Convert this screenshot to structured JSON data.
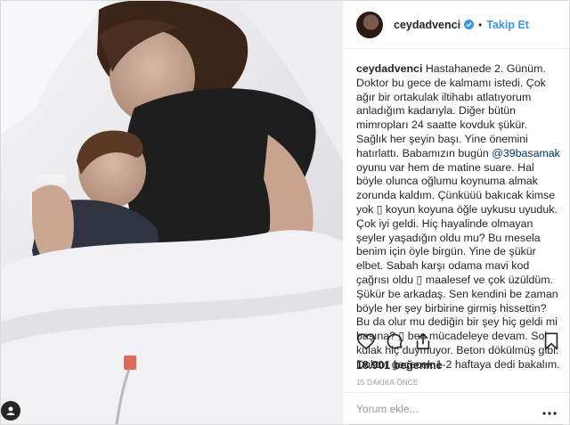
{
  "post": {
    "username": "ceydadvenci",
    "follow_label": "Takip Et",
    "separator": "•",
    "caption": {
      "author": "ceydadvenci",
      "text_before_mention": " Hastahanede 2. Günüm. Doktor bu gece de kalmamı istedi. Çok ağır bir ortakulak iltihabı atlatıyorum anladığım kadarıyla. Diğer bütün mimropları 24 saatte kovduk şükür. Sağlık her şeyin başı. Yine önemini hatırlattı. Babamızın bugün ",
      "mention": "@39basamak",
      "text_after_mention": " oyunu var hem de matine suare. Hal böyle olunca oğlumu koynuma almak zorunda kaldım. Çünküüü bakıcak kimse yok ▯ koyun koyuna öğle uykusu uyuduk. Çok iyi geldi. Hiç hayalinde olmayan şeyler yaşadığın oldu mu? Bu mesela benim için öyle birgün. Yine de şükür elbet. Sabah karşı odama mavi kod çağrısı oldu ▯ maalesef ve çok üzüldüm. Şükür be arkadaş. Sen kendini be zaman böyle her şey birbirine girmiş hissettin? Bu da olur mu dediğin bir şey hiç geldi mi başına? ▯ ben mücadeleye devam. Sol kulak hiç duymuyor. Beton dökülmüş gibi. Doktor geçecek 1-2 haftaya dedi bakalım."
    },
    "likes": "18.901 beğenme",
    "timestamp": "15 DAKİKA ÖNCE",
    "comment_placeholder": "Yorum ekle...",
    "icons": {
      "like": "heart-icon",
      "comment": "comment-icon",
      "share": "share-icon",
      "save": "bookmark-icon",
      "more": "more-icon",
      "verified": "verified-badge-icon",
      "tagged_user": "user-tag-icon"
    },
    "colors": {
      "link": "#3897f0",
      "mention": "#003569",
      "text": "#262626",
      "muted": "#999999"
    }
  }
}
